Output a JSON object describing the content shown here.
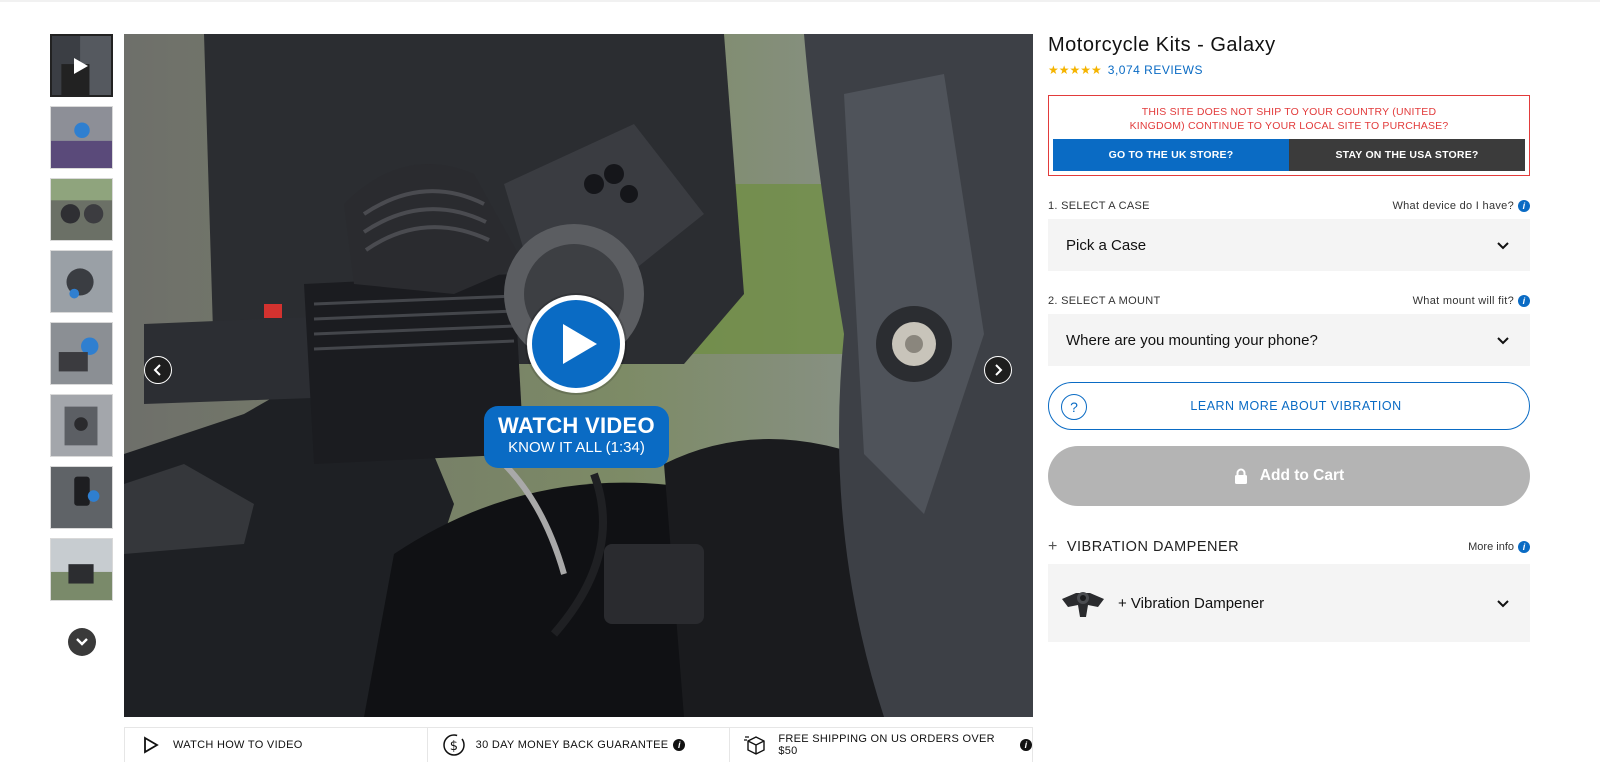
{
  "thumbnails": [
    {
      "name": "video"
    },
    {
      "name": "photo-2"
    },
    {
      "name": "photo-3"
    },
    {
      "name": "photo-4"
    },
    {
      "name": "photo-5"
    },
    {
      "name": "photo-6"
    },
    {
      "name": "photo-7"
    },
    {
      "name": "photo-8"
    }
  ],
  "hero": {
    "watch_title": "WATCH VIDEO",
    "watch_subtitle": "KNOW IT ALL (1:34)"
  },
  "benefits": [
    {
      "icon": "play-outline-icon",
      "label": "WATCH HOW TO VIDEO",
      "info": false
    },
    {
      "icon": "dollar-circle-icon",
      "label": "30 DAY MONEY BACK GUARANTEE",
      "info": true
    },
    {
      "icon": "box-icon",
      "label": "FREE SHIPPING ON US ORDERS OVER $50",
      "info": true
    }
  ],
  "product": {
    "title": "Motorcycle Kits - Galaxy",
    "stars": "★★★★★",
    "reviews": "3,074 REVIEWS"
  },
  "geo": {
    "message": "THIS SITE DOES NOT SHIP TO YOUR COUNTRY (UNITED KINGDOM) CONTINUE TO YOUR LOCAL SITE TO PURCHASE?",
    "uk_button": "GO TO THE UK STORE?",
    "usa_button": "STAY ON THE USA STORE?"
  },
  "case_select": {
    "label": "1. SELECT A CASE",
    "help": "What device do I have?",
    "value": "Pick a Case"
  },
  "mount_select": {
    "label": "2. SELECT A MOUNT",
    "help": "What mount will fit?",
    "value": "Where are you mounting your phone?"
  },
  "learn_more": "LEARN MORE ABOUT VIBRATION",
  "cart": "Add to Cart",
  "vibration": {
    "title": "VIBRATION DAMPENER",
    "more": "More info",
    "value": "+ Vibration Dampener"
  },
  "colors": {
    "brand_blue": "#0a6bc4",
    "alert_red": "#e23b3b",
    "stars": "#f5b400",
    "cart_disabled": "#b4b4b4"
  }
}
